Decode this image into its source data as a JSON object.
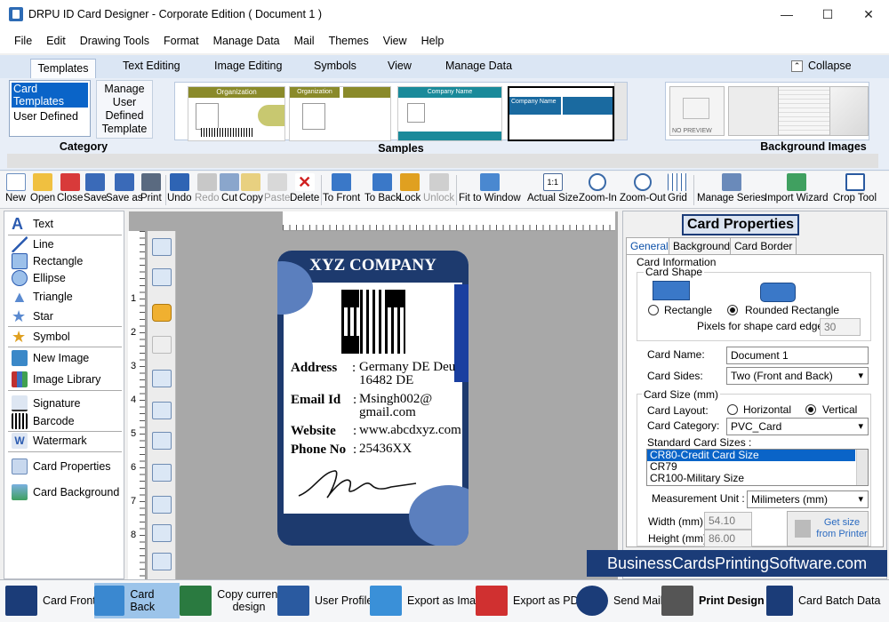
{
  "window": {
    "title": "DRPU ID Card Designer - Corporate Edition ( Document 1 )",
    "min": "—",
    "max": "☐",
    "close": "✕"
  },
  "menu": [
    "File",
    "Edit",
    "Drawing Tools",
    "Format",
    "Manage Data",
    "Mail",
    "Themes",
    "View",
    "Help"
  ],
  "ribbon_tabs": [
    "Templates",
    "Text Editing",
    "Image Editing",
    "Symbols",
    "View",
    "Manage Data"
  ],
  "collapse": "Collapse",
  "category": {
    "items": [
      "Card Templates",
      "User Defined"
    ],
    "button": "Manage User Defined Template",
    "label": "Category"
  },
  "samples": {
    "label": "Samples",
    "cards": [
      "Organization",
      "Organization",
      "Company Name",
      "Company Name"
    ]
  },
  "background_images": {
    "label": "Background Images",
    "no_preview": "NO PREVIEW"
  },
  "toolbar": [
    "New",
    "Open",
    "Close",
    "Save",
    "Save as",
    "Print",
    "Undo",
    "Redo",
    "Cut",
    "Copy",
    "Paste",
    "Delete",
    "To Front",
    "To Back",
    "Lock",
    "Unlock",
    "Fit to Window",
    "Actual Size",
    "Zoom-In",
    "Zoom-Out",
    "Grid",
    "Manage Series",
    "Import Wizard",
    "Crop Tool"
  ],
  "left_tools": [
    "Text",
    "Line",
    "Rectangle",
    "Ellipse",
    "Triangle",
    "Star",
    "Symbol",
    "New Image",
    "Image Library",
    "Signature",
    "Barcode",
    "Watermark",
    "Card Properties",
    "Card Background"
  ],
  "ruler_numbers": [
    "1",
    "2",
    "3",
    "4",
    "5",
    "6",
    "7",
    "8"
  ],
  "card": {
    "company": "XYZ COMPANY",
    "fields": [
      {
        "label": "Address",
        "value": "Germany DE Deu 16482 DE"
      },
      {
        "label": "Email Id",
        "value": "Msingh002@ gmail.com"
      },
      {
        "label": "Website",
        "value": "www.abcdxyz.com"
      },
      {
        "label": "Phone No",
        "value": "25436XX"
      }
    ],
    "colon": ":"
  },
  "props": {
    "title": "Card Properties",
    "tabs": [
      "General",
      "Background",
      "Card Border"
    ],
    "card_information": "Card Information",
    "card_shape": "Card Shape",
    "shape_rect": "Rectangle",
    "shape_rounded": "Rounded Rectangle",
    "pixels_label": "Pixels for shape card edge :",
    "pixels_value": "30",
    "card_name_label": "Card Name:",
    "card_name_value": "Document 1",
    "card_sides_label": "Card Sides:",
    "card_sides_value": "Two (Front and Back)",
    "card_size": "Card Size (mm)",
    "layout_label": "Card Layout:",
    "layout_h": "Horizontal",
    "layout_v": "Vertical",
    "category_label": "Card Category:",
    "category_value": "PVC_Card",
    "standard_label": "Standard Card Sizes :",
    "standard_sizes": [
      "CR80-Credit Card Size",
      "CR79",
      "CR100-Military Size"
    ],
    "unit_label": "Measurement Unit :",
    "unit_value": "Milimeters (mm)",
    "width_label": "Width  (mm)",
    "width_value": "54.10",
    "height_label": "Height  (mm)",
    "height_value": "86.00",
    "get_size": "Get size from Printer"
  },
  "watermark": "BusinessCardsPrintingSoftware.com",
  "bottom": [
    "Card Front",
    "Card Back",
    "Copy current design",
    "User Profile",
    "Export as Image",
    "Export as PDF",
    "Send Mail",
    "Print Design",
    "Card Batch Data"
  ]
}
